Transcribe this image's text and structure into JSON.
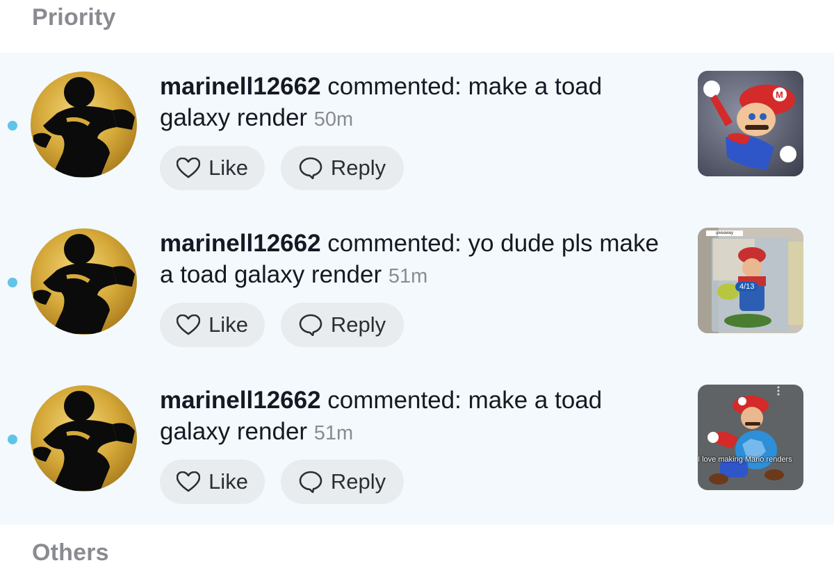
{
  "sections": {
    "priority": "Priority",
    "others": "Others"
  },
  "notifications": [
    {
      "username": "marinell12662",
      "message": " commented: make a toad galaxy render ",
      "time": "50m",
      "like_label": "Like",
      "reply_label": "Reply",
      "thumbnail_icon": "mario-flying-thumbnail"
    },
    {
      "username": "marinell12662",
      "message": " commented: yo dude pls make a toad galaxy render ",
      "time": "51m",
      "like_label": "Like",
      "reply_label": "Reply",
      "thumbnail_icon": "mario-figure-giveaway-thumbnail",
      "thumbnail_tag": "giveaway",
      "thumbnail_badge": "4/13"
    },
    {
      "username": "marinell12662",
      "message": " commented: make a toad galaxy render ",
      "time": "51m",
      "like_label": "Like",
      "reply_label": "Reply",
      "thumbnail_icon": "mario-shell-thumbnail",
      "thumbnail_caption": "I love making Mario renders"
    }
  ],
  "colors": {
    "unread_dot": "#5ec4e8",
    "priority_bg": "#f3f9fc",
    "button_bg": "#e8ecef",
    "muted_text": "#8a8b91"
  }
}
